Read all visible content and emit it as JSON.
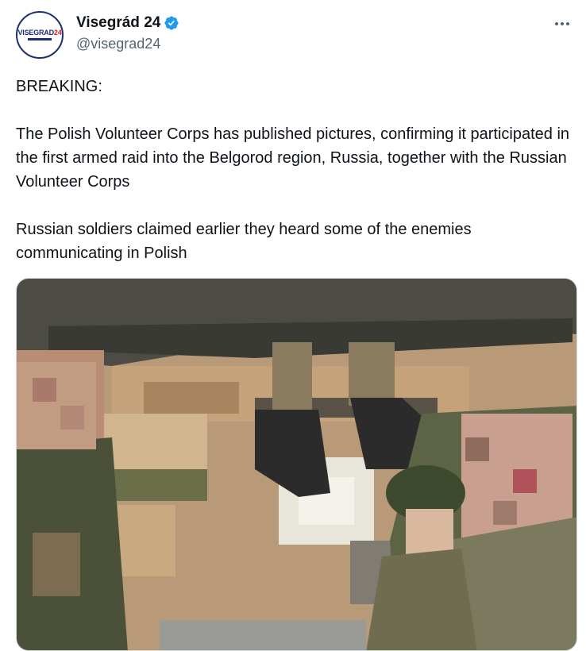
{
  "account": {
    "display_name": "Visegrád 24",
    "handle": "@visegrad24",
    "verified": true,
    "avatar_logo_text_main": "VISEGRAD",
    "avatar_logo_text_num": "24"
  },
  "menu": {
    "icon": "more-options-icon"
  },
  "tweet": {
    "text": "BREAKING:\n\nThe Polish Volunteer Corps has published pictures, confirming it participated in the first armed raid into the Belgorod region, Russia, together with the Russian Volunteer Corps\n\nRussian soldiers claimed earlier they heard some of the enemies communicating in Polish"
  },
  "media": {
    "type": "photo"
  },
  "colors": {
    "brand_blue": "#1d2f6f",
    "brand_red": "#d8232a",
    "verified_blue": "#1d9bf0",
    "secondary_text": "#536471"
  }
}
